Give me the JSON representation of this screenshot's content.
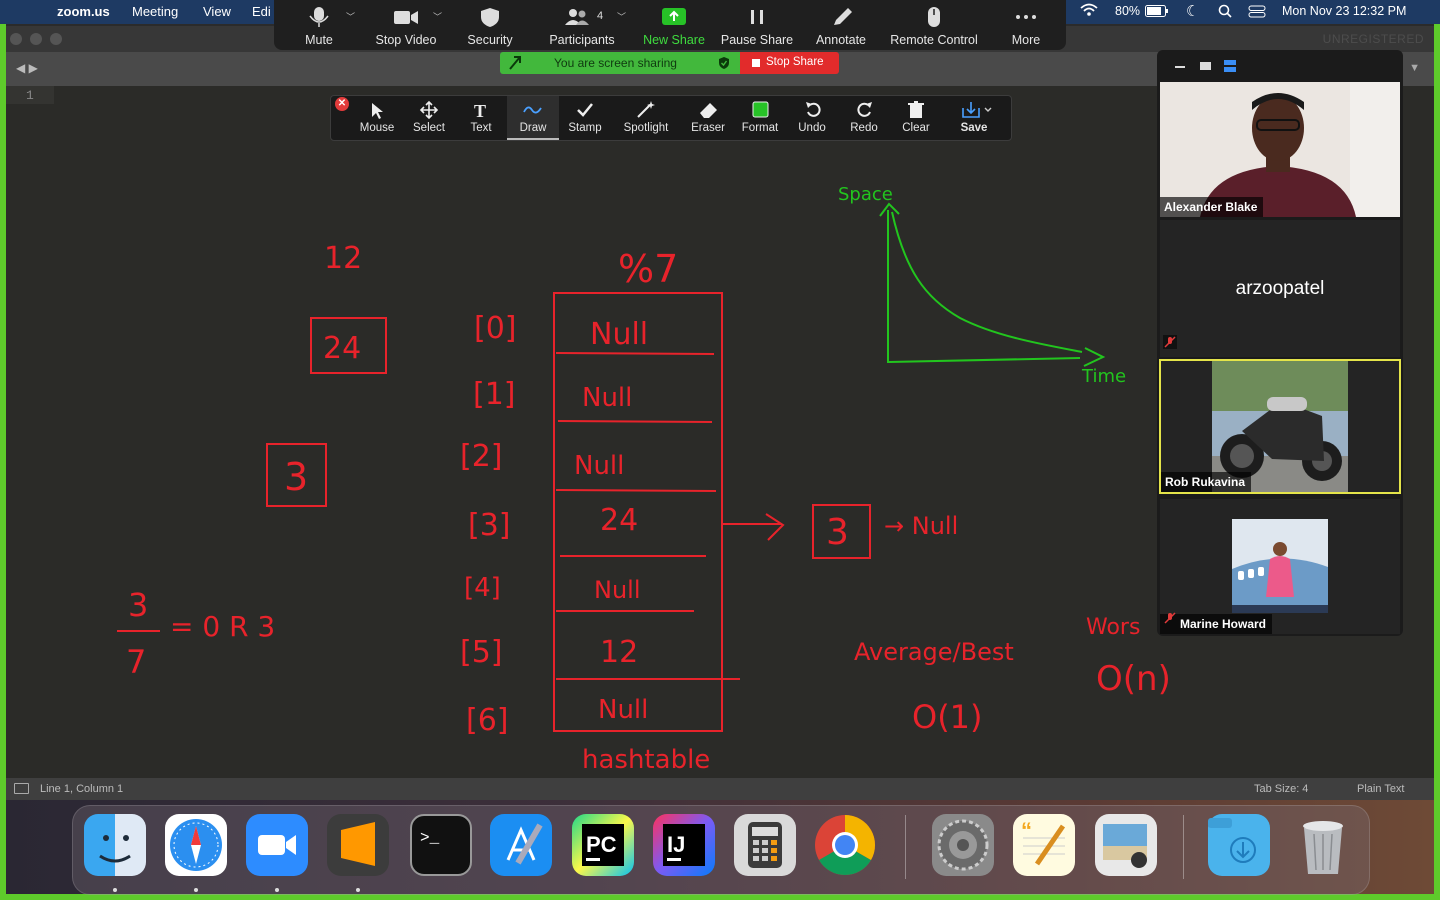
{
  "menubar": {
    "app": "zoom.us",
    "items": [
      "Meeting",
      "View",
      "Edi"
    ],
    "battery": "80%",
    "datetime": "Mon Nov 23  12:32 PM"
  },
  "zoom_toolbar": {
    "mute": "Mute",
    "stop_video": "Stop Video",
    "security": "Security",
    "participants": "Participants",
    "participants_count": "4",
    "new_share": "New Share",
    "pause_share": "Pause Share",
    "annotate": "Annotate",
    "remote_control": "Remote Control",
    "more": "More"
  },
  "share_banner": {
    "text": "You are screen sharing",
    "stop": "Stop Share"
  },
  "annotation_toolbar": {
    "tools": [
      "Mouse",
      "Select",
      "Text",
      "Draw",
      "Stamp",
      "Spotlight",
      "Eraser",
      "Format",
      "Undo",
      "Redo",
      "Clear",
      "Save"
    ],
    "active": "Draw"
  },
  "editor": {
    "watermark": "UNREGISTERED",
    "line_number": "1",
    "status_position": "Line 1, Column 1",
    "tab_size": "Tab Size: 4",
    "syntax": "Plain Text"
  },
  "participants": {
    "tiles": [
      {
        "name": "Alexander Blake"
      },
      {
        "name": "arzoopatel"
      },
      {
        "name": "Rob Rukavina"
      },
      {
        "name": "Marine Howard"
      }
    ]
  },
  "annotations": {
    "n12": "12",
    "n24": "24",
    "n3": "3",
    "frac_num": "3",
    "frac_den": "7",
    "frac_rest": "= 0 R 3",
    "mod": "%7",
    "indices": [
      "[0]",
      "[1]",
      "[2]",
      "[3]",
      "[4]",
      "[5]",
      "[6]"
    ],
    "cells": [
      "Null",
      "Null",
      "Null",
      "24",
      "Null",
      "12",
      "Null"
    ],
    "hashtable": "hashtable",
    "node_value": "3",
    "node_next": "→ Null",
    "space": "Space",
    "time": "Time",
    "avg_best": "Average/Best",
    "o1": "O(1)",
    "worst": "Wors",
    "on": "O(n)"
  },
  "colors": {
    "share_green": "#5ecb2b",
    "annotation_red": "#e8232b",
    "annotation_green": "#22c51e",
    "stop_red": "#e22b2b"
  }
}
